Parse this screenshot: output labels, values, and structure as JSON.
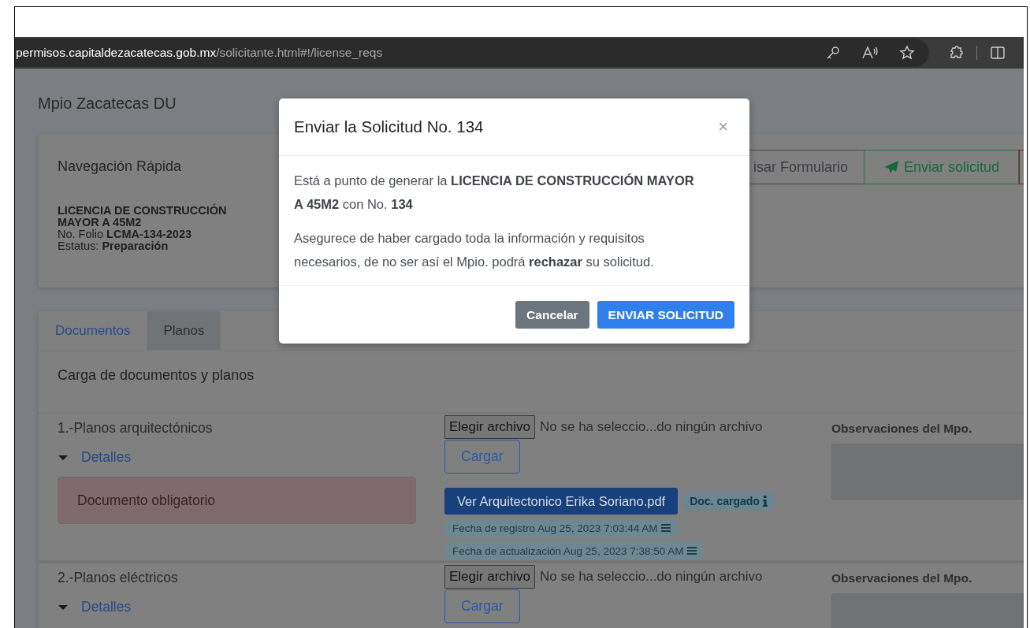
{
  "browser": {
    "url_host": "permisos.capitaldezacatecas.gob.mx",
    "url_path": "/solicitante.html#!/license_reqs"
  },
  "page": {
    "title": "Mpio Zacatecas DU"
  },
  "quick_nav": {
    "title": "Navegación Rápida",
    "license": "LICENCIA DE CONSTRUCCIÓN MAYOR A 45M2",
    "folio": "No. Folio **LCMA-134-2023**",
    "status": "Estatus: **Preparación**",
    "actions": [
      {
        "kind": "plain",
        "label": "isar Formulario"
      },
      {
        "kind": "send",
        "label": "Enviar solicitud"
      },
      {
        "kind": "danger-edge"
      }
    ]
  },
  "tabs": [
    {
      "label": "Documentos",
      "selected": false
    },
    {
      "label": "Planos",
      "selected": true
    }
  ],
  "section_title": "Carga de documentos y planos",
  "items": [
    {
      "title": "1.-Planos arquitectónicos",
      "details": "Detalles",
      "expanded": true,
      "alert": "Documento obligatorio",
      "file_button": "Elegir archivo",
      "file_status": "No se ha seleccio...do ningún archivo",
      "upload": "Cargar",
      "file_link": "Ver Arquitectonico Erika Soriano.pdf",
      "file_badge": "Doc. cargado",
      "dates": [
        "Fecha de registro Aug 25, 2023 7:03:44 AM",
        "Fecha de actualización Aug 25, 2023 7:38:50 AM"
      ],
      "obs_label": "Observaciones del Mpo."
    },
    {
      "title": "2.-Planos eléctricos",
      "details": "Detalles",
      "expanded": true,
      "file_button": "Elegir archivo",
      "file_status": "No se ha seleccio...do ningún archivo",
      "upload": "Cargar",
      "obs_label": "Observaciones del Mpo."
    }
  ],
  "modal": {
    "title": "Enviar la Solicitud No. 134",
    "close": "×",
    "paragraphs": [
      "Está a punto de generar la **LICENCIA DE CONSTRUCCIÓN MAYOR A 45M2** con No. **134**",
      "Asegurece de haber cargado toda la información y requisitos necesarios, de no ser así el Mpio. podrá **rechazar** su solicitud."
    ],
    "buttons": [
      {
        "kind": "secondary",
        "label": "Cancelar"
      },
      {
        "kind": "primary",
        "label": "ENVIAR SOLICITUD"
      }
    ]
  }
}
